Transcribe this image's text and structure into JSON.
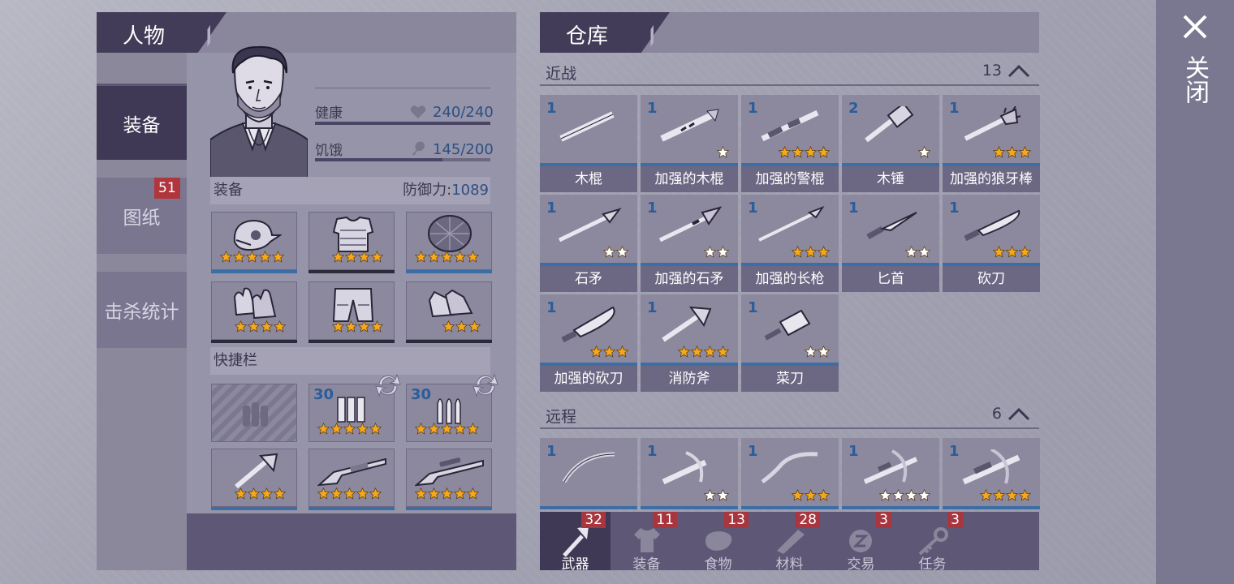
{
  "character": {
    "tab_title": "人物",
    "sidebar": [
      {
        "label": "装备",
        "active": true
      },
      {
        "label": "图纸",
        "badge": "51"
      },
      {
        "label": "击杀统计"
      }
    ],
    "stats": {
      "health_label": "健康",
      "health_value": "240/240",
      "health_fraction": 1.0,
      "hunger_label": "饥饿",
      "hunger_value": "145/200",
      "hunger_fraction": 0.725
    },
    "equipment": {
      "section_label": "装备",
      "defense_label": "防御力:",
      "defense_value": "1089",
      "slots": [
        {
          "icon": "helmet-icon",
          "stars": 5
        },
        {
          "icon": "armor-vest-icon",
          "stars": 4
        },
        {
          "icon": "turtle-shell-icon",
          "stars": 5
        },
        {
          "icon": "gloves-icon",
          "stars": 4
        },
        {
          "icon": "pants-icon",
          "stars": 4
        },
        {
          "icon": "boots-icon",
          "stars": 3
        }
      ]
    },
    "quickbar": {
      "section_label": "快捷栏",
      "slots": [
        {
          "icon": "empty-ammo-icon",
          "empty": true
        },
        {
          "icon": "shotgun-shells-icon",
          "count": "30",
          "stars": 5
        },
        {
          "icon": "rifle-rounds-icon",
          "count": "30",
          "stars": 5
        },
        {
          "icon": "fire-axe-icon",
          "stars": 4
        },
        {
          "icon": "shotgun-icon",
          "stars": 5
        },
        {
          "icon": "rifle-icon",
          "stars": 5
        }
      ]
    }
  },
  "warehouse": {
    "tab_title": "仓库",
    "melee": {
      "label": "近战",
      "count": "13",
      "items": [
        {
          "qty": "1",
          "name": "木棍",
          "stars": 0
        },
        {
          "qty": "1",
          "name": "加强的木棍",
          "stars": 1
        },
        {
          "qty": "1",
          "name": "加强的警棍",
          "stars": 4
        },
        {
          "qty": "2",
          "name": "木锤",
          "stars": 1
        },
        {
          "qty": "1",
          "name": "加强的狼牙棒",
          "stars": 3
        },
        {
          "qty": "1",
          "name": "石矛",
          "stars": 2
        },
        {
          "qty": "1",
          "name": "加强的石矛",
          "stars": 2
        },
        {
          "qty": "1",
          "name": "加强的长枪",
          "stars": 3
        },
        {
          "qty": "1",
          "name": "匕首",
          "stars": 2
        },
        {
          "qty": "1",
          "name": "砍刀",
          "stars": 3
        },
        {
          "qty": "1",
          "name": "加强的砍刀",
          "stars": 3
        },
        {
          "qty": "1",
          "name": "消防斧",
          "stars": 4
        },
        {
          "qty": "1",
          "name": "菜刀",
          "stars": 2
        }
      ]
    },
    "ranged": {
      "label": "远程",
      "count": "6",
      "items": [
        {
          "qty": "1",
          "stars": 0
        },
        {
          "qty": "1",
          "stars": 2
        },
        {
          "qty": "1",
          "stars": 3
        },
        {
          "qty": "1",
          "stars": 4
        },
        {
          "qty": "1",
          "stars": 4
        }
      ]
    },
    "bottom_tabs": [
      {
        "label": "武器",
        "badge": "32",
        "active": true
      },
      {
        "label": "装备",
        "badge": "11"
      },
      {
        "label": "食物",
        "badge": "13"
      },
      {
        "label": "材料",
        "badge": "28"
      },
      {
        "label": "交易",
        "badge": "3"
      },
      {
        "label": "任务",
        "badge": "3"
      }
    ]
  },
  "close_label": "关闭",
  "colors": {
    "gold_star": "#f5a81d",
    "silver_star": "#ffffff",
    "accent_blue": "#3b6ea4",
    "badge_red": "#b0363d"
  }
}
